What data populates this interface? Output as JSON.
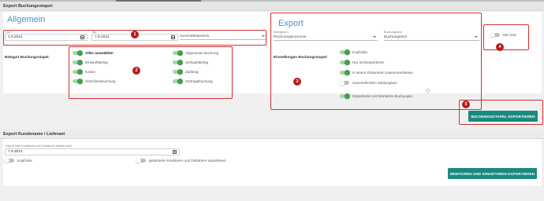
{
  "export_stapel": {
    "header": "Export Buchungsstapel:",
    "allgemein": {
      "title": "Allgemein",
      "von_label": "Von",
      "von_value": "1.9.2021",
      "bis_label": "Bis",
      "bis_value": "7.9.2021",
      "geschaeftsbereich_placeholder": "Geschäftsbereich",
      "belegart_label": "Belegart Buchungsstapel:",
      "toggles_left": [
        {
          "label": "Alles auswählen",
          "on": true
        },
        {
          "label": "Einkaufsbeleg",
          "on": true
        },
        {
          "label": "Kasse",
          "on": true
        },
        {
          "label": "Abschlussbuchung",
          "on": true
        }
      ],
      "toggles_right": [
        {
          "label": "Allgemeine Buchung",
          "on": true
        },
        {
          "label": "Verkaufsbeleg",
          "on": true
        },
        {
          "label": "Zahlung",
          "on": true
        },
        {
          "label": "Vortragsbuchung",
          "on": true
        }
      ]
    },
    "export": {
      "title": "Export",
      "belegfeld_label": "Belegfeld 1",
      "belegfeld_value": "Rechnungsnummer",
      "buchungstext_label": "Buchungstext",
      "buchungstext_value": "Buchungstext",
      "einstellungen_label": "Einstellungen Buchungsstapel:",
      "toggles": [
        {
          "label": "Kopfzeile",
          "on": true
        },
        {
          "label": "Nur nichtexportierte",
          "on": true
        },
        {
          "label": "in einem Dokument zusammenfassen",
          "on": true
        },
        {
          "label": "Sammelkonten Zahlungsart",
          "on": false
        },
        {
          "label": "Exportieren mit Stornierte Buchungen",
          "on": true
        }
      ]
    },
    "mit_oss": {
      "label": "Mit OSS",
      "on": false
    },
    "export_button": "BUCHUNGSSTAPEL EXPORTIEREN"
  },
  "export_kunden": {
    "header": "Export Kundename / Lieferant",
    "date_label": "Export aller Kreditoren und Debitoren erstellt nach",
    "date_value": "7.9.2021",
    "kopfzeile": {
      "label": "Kopfzeile",
      "on": false
    },
    "geaenderte": {
      "label": "geänderte Kreditoren und Debitoren exportieren",
      "on": false
    },
    "export_button": "DEBITOREN UND KREDITOREN EXPORTIEREN"
  },
  "annotations": [
    "1",
    "2",
    "3",
    "4",
    "5"
  ],
  "colors": {
    "accent": "#4a90c8",
    "toggle_on": "#43a047",
    "button": "#1a8a7e",
    "annotation": "#d32f2f"
  }
}
